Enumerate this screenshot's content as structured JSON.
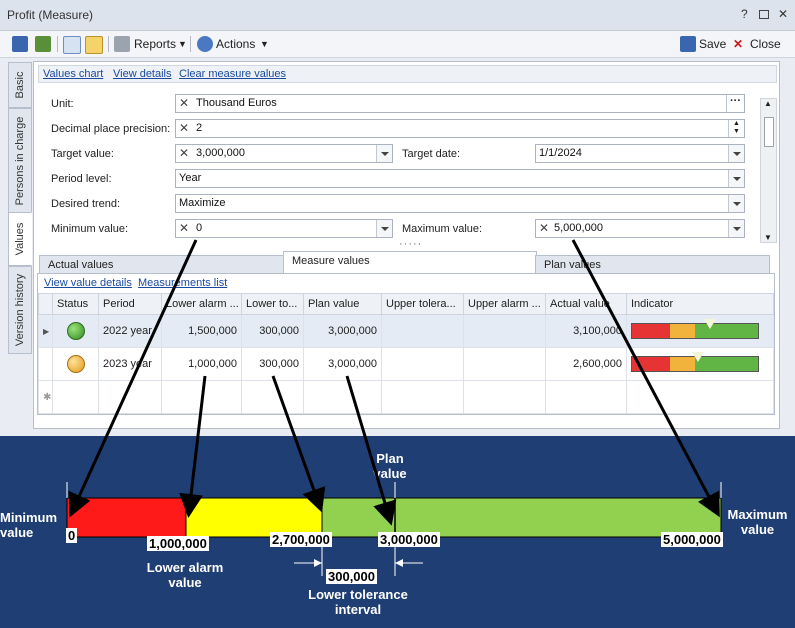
{
  "window": {
    "title": "Profit (Measure)",
    "help": "?",
    "restore": "▫",
    "close": "✕"
  },
  "toolbar": {
    "reports": "Reports",
    "actions": "Actions",
    "save": "Save",
    "close": "Close"
  },
  "side_tabs": [
    "Basic",
    "Persons in charge",
    "Values",
    "Version history"
  ],
  "top_links": [
    "Values chart",
    "View details",
    "Clear measure values"
  ],
  "form": {
    "unit_label": "Unit:",
    "unit_value": "Thousand Euros",
    "precision_label": "Decimal place precision:",
    "precision_value": "2",
    "target_label": "Target value:",
    "target_value": "3,000,000",
    "target_date_label": "Target date:",
    "target_date_value": "1/1/2024",
    "period_label": "Period level:",
    "period_value": "Year",
    "trend_label": "Desired trend:",
    "trend_value": "Maximize",
    "min_label": "Minimum value:",
    "min_value": "0",
    "max_label": "Maximum value:",
    "max_value": "5,000,000"
  },
  "tabs": [
    "Actual values",
    "Measure values",
    "Plan values"
  ],
  "grid_links": [
    "View value details",
    "Measurements list"
  ],
  "grid": {
    "columns": [
      "Status",
      "Period",
      "Lower alarm ...",
      "Lower to...",
      "Plan value",
      "Upper tolera...",
      "Upper alarm ...",
      "Actual value",
      "Indicator"
    ],
    "rows": [
      {
        "status": "green",
        "period": "2022 year",
        "lower_alarm": "1,500,000",
        "lower_tol": "300,000",
        "plan": "3,000,000",
        "upper_tol": "",
        "upper_alarm": "",
        "actual": "3,100,000",
        "indicator": 0.62
      },
      {
        "status": "orange",
        "period": "2023 year",
        "lower_alarm": "1,000,000",
        "lower_tol": "300,000",
        "plan": "3,000,000",
        "upper_tol": "",
        "upper_alarm": "",
        "actual": "2,600,000",
        "indicator": 0.52
      }
    ]
  },
  "scale": {
    "plan_label": "Plan\nvalue",
    "min_label": "Minimum\nvalue",
    "max_label": "Maximum\nvalue",
    "lower_alarm_label": "Lower alarm\nvalue",
    "tolerance_label": "Lower tolerance\ninterval",
    "v0": "0",
    "v_alarm": "1,000,000",
    "v_tol": "2,700,000",
    "v_plan": "3,000,000",
    "v_max": "5,000,000",
    "v_interval": "300,000",
    "colors": {
      "red": "#ff1a1a",
      "yellow": "#ffff00",
      "green": "#92d050"
    }
  }
}
